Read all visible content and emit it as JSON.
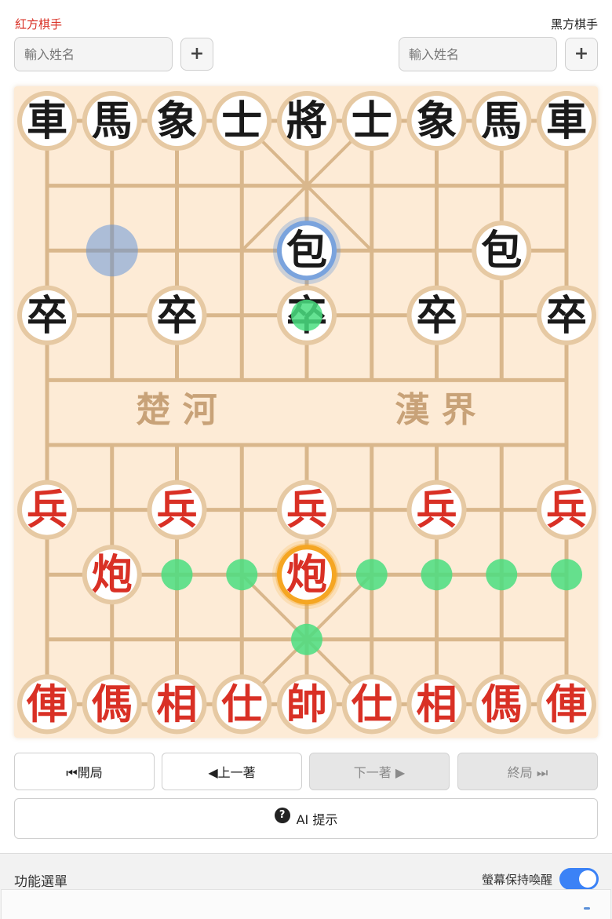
{
  "players": {
    "red": {
      "label": "紅方棋手",
      "placeholder": "輸入姓名",
      "add_label": "+"
    },
    "black": {
      "label": "黑方棋手",
      "placeholder": "輸入姓名",
      "add_label": "+"
    }
  },
  "board": {
    "river_left": "楚 河",
    "river_right": "漢 界",
    "pieces": [
      {
        "t": "車",
        "s": "black",
        "c": 0,
        "r": 0
      },
      {
        "t": "馬",
        "s": "black",
        "c": 1,
        "r": 0
      },
      {
        "t": "象",
        "s": "black",
        "c": 2,
        "r": 0
      },
      {
        "t": "士",
        "s": "black",
        "c": 3,
        "r": 0
      },
      {
        "t": "將",
        "s": "black",
        "c": 4,
        "r": 0
      },
      {
        "t": "士",
        "s": "black",
        "c": 5,
        "r": 0
      },
      {
        "t": "象",
        "s": "black",
        "c": 6,
        "r": 0
      },
      {
        "t": "馬",
        "s": "black",
        "c": 7,
        "r": 0
      },
      {
        "t": "車",
        "s": "black",
        "c": 8,
        "r": 0
      },
      {
        "t": "包",
        "s": "black",
        "c": 4,
        "r": 2
      },
      {
        "t": "包",
        "s": "black",
        "c": 7,
        "r": 2
      },
      {
        "t": "卒",
        "s": "black",
        "c": 0,
        "r": 3
      },
      {
        "t": "卒",
        "s": "black",
        "c": 2,
        "r": 3
      },
      {
        "t": "卒",
        "s": "black",
        "c": 4,
        "r": 3
      },
      {
        "t": "卒",
        "s": "black",
        "c": 6,
        "r": 3
      },
      {
        "t": "卒",
        "s": "black",
        "c": 8,
        "r": 3
      },
      {
        "t": "兵",
        "s": "red",
        "c": 0,
        "r": 6
      },
      {
        "t": "兵",
        "s": "red",
        "c": 2,
        "r": 6
      },
      {
        "t": "兵",
        "s": "red",
        "c": 4,
        "r": 6
      },
      {
        "t": "兵",
        "s": "red",
        "c": 6,
        "r": 6
      },
      {
        "t": "兵",
        "s": "red",
        "c": 8,
        "r": 6
      },
      {
        "t": "炮",
        "s": "red",
        "c": 1,
        "r": 7
      },
      {
        "t": "炮",
        "s": "red",
        "c": 4,
        "r": 7
      },
      {
        "t": "俥",
        "s": "red",
        "c": 0,
        "r": 9
      },
      {
        "t": "傌",
        "s": "red",
        "c": 1,
        "r": 9
      },
      {
        "t": "相",
        "s": "red",
        "c": 2,
        "r": 9
      },
      {
        "t": "仕",
        "s": "red",
        "c": 3,
        "r": 9
      },
      {
        "t": "帥",
        "s": "red",
        "c": 4,
        "r": 9
      },
      {
        "t": "仕",
        "s": "red",
        "c": 5,
        "r": 9
      },
      {
        "t": "相",
        "s": "red",
        "c": 6,
        "r": 9
      },
      {
        "t": "傌",
        "s": "red",
        "c": 7,
        "r": 9
      },
      {
        "t": "俥",
        "s": "red",
        "c": 8,
        "r": 9
      }
    ],
    "selected": {
      "c": 4,
      "r": 7
    },
    "last_move_from": {
      "c": 1,
      "r": 2
    },
    "last_move_to": {
      "c": 4,
      "r": 2
    },
    "hints": [
      {
        "c": 2,
        "r": 7
      },
      {
        "c": 3,
        "r": 7
      },
      {
        "c": 5,
        "r": 7
      },
      {
        "c": 6,
        "r": 7
      },
      {
        "c": 7,
        "r": 7
      },
      {
        "c": 8,
        "r": 7
      },
      {
        "c": 4,
        "r": 8
      },
      {
        "c": 4,
        "r": 3
      }
    ]
  },
  "controls": {
    "start": "⏮開局",
    "prev": "◀上一著",
    "next": "下一著 ▶",
    "end": "終局 ⏭"
  },
  "ai_hint": {
    "icon": "?",
    "label": "AI 提示"
  },
  "bottom": {
    "menu_label": "功能選單",
    "wake_label": "螢幕保持喚醒",
    "wake_on": true
  },
  "colors": {
    "board_bg": "#fdebd6",
    "line": "#d9b78c",
    "red_piece": "#d93025",
    "black_piece": "#1a1a1a",
    "hint": "#4ade80",
    "selected_glow": "#f5a623",
    "last_move": "#5b8fd8"
  }
}
